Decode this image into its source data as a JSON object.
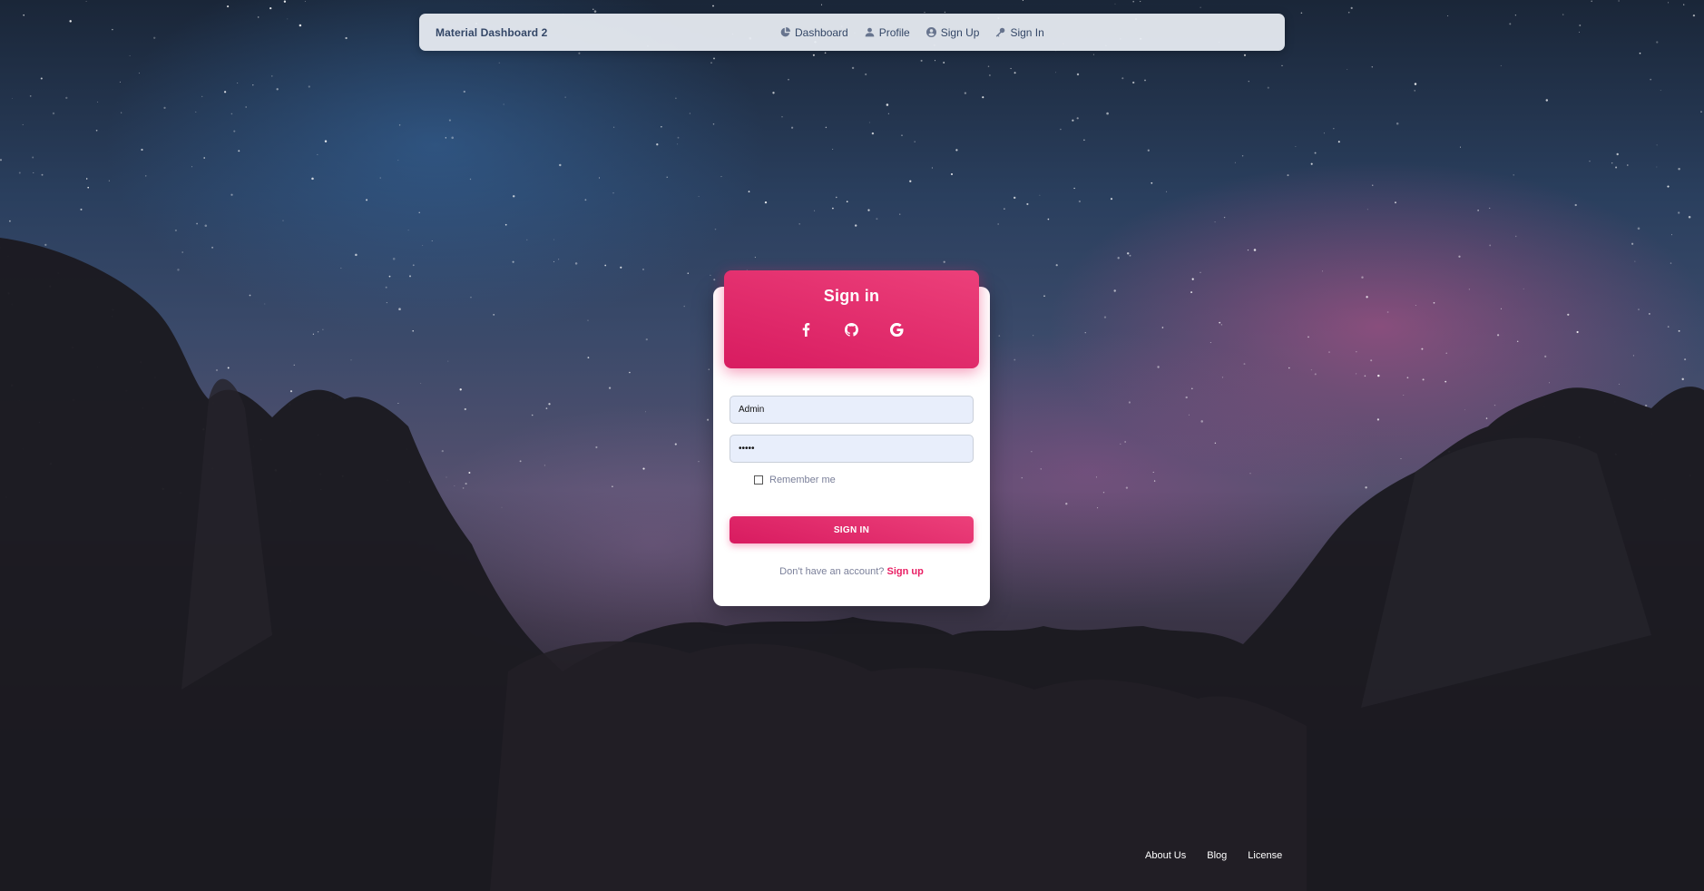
{
  "navbar": {
    "brand": "Material Dashboard 2",
    "links": [
      {
        "label": "Dashboard",
        "icon": "pie-chart-icon"
      },
      {
        "label": "Profile",
        "icon": "person-icon"
      },
      {
        "label": "Sign Up",
        "icon": "account-circle-icon"
      },
      {
        "label": "Sign In",
        "icon": "key-icon"
      }
    ]
  },
  "card": {
    "title": "Sign in",
    "socials": [
      "facebook-icon",
      "github-icon",
      "google-icon"
    ],
    "username_value": "Admin",
    "password_value": "•••••",
    "remember_label": "Remember me",
    "remember_checked": false,
    "submit_label": "SIGN IN",
    "no_account_text": "Don't have an account?",
    "signup_link": "Sign up"
  },
  "footer": {
    "links": [
      "About Us",
      "Blog",
      "License"
    ]
  },
  "colors": {
    "accent": "#e91e63",
    "accent_light": "#ec407a",
    "text_dark": "#344767",
    "text_muted": "#7b809a"
  }
}
